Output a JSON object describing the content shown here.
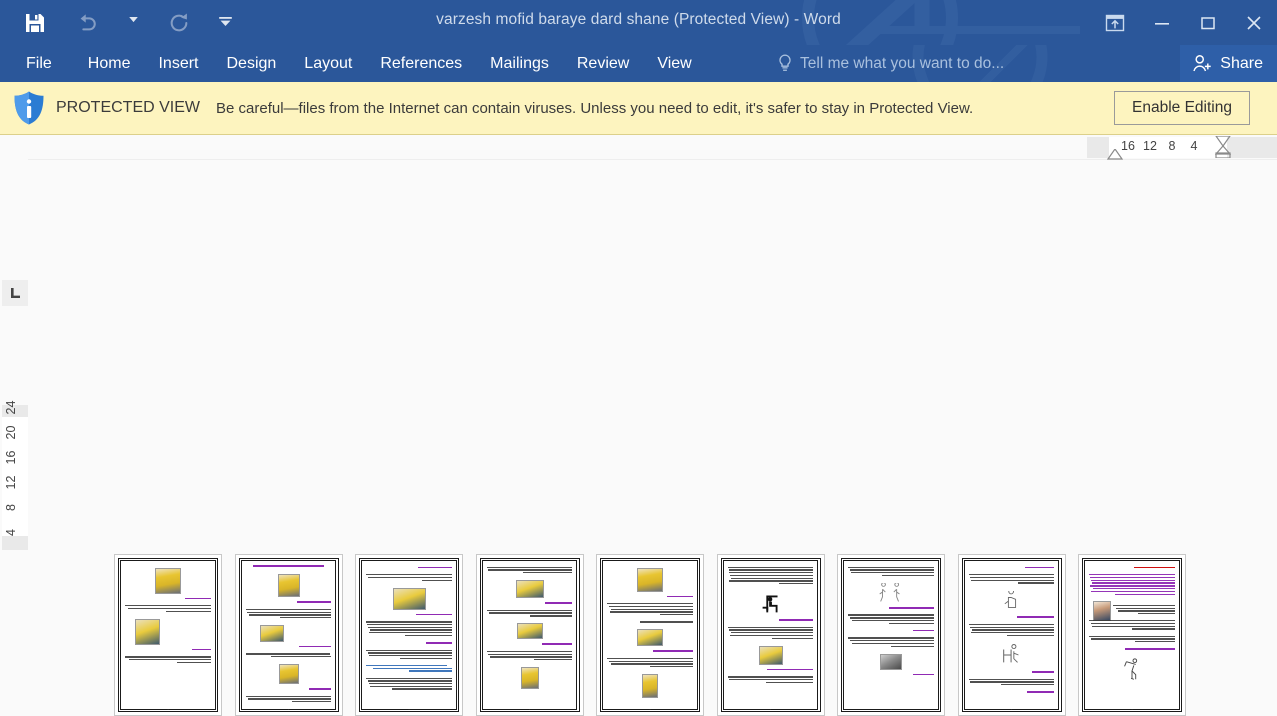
{
  "window": {
    "title": "varzesh mofid baraye dard shane (Protected View) - Word",
    "accent_color": "#2b579a",
    "quick_access": [
      {
        "name": "save-icon",
        "label": "Save",
        "enabled": true
      },
      {
        "name": "undo-icon",
        "label": "Undo",
        "enabled": false
      },
      {
        "name": "redo-icon",
        "label": "Redo",
        "enabled": false
      },
      {
        "name": "customize-quick-access-toolbar-icon",
        "label": "Customize Quick Access Toolbar",
        "enabled": true
      }
    ],
    "controls": [
      {
        "name": "ribbon-display-options-icon",
        "label": "Ribbon Display Options"
      },
      {
        "name": "minimize-icon",
        "label": "Minimize"
      },
      {
        "name": "restore-icon",
        "label": "Restore Down"
      },
      {
        "name": "close-icon",
        "label": "Close"
      }
    ]
  },
  "ribbon": {
    "tabs": [
      {
        "label": "File"
      },
      {
        "label": "Home"
      },
      {
        "label": "Insert"
      },
      {
        "label": "Design"
      },
      {
        "label": "Layout"
      },
      {
        "label": "References"
      },
      {
        "label": "Mailings"
      },
      {
        "label": "Review"
      },
      {
        "label": "View"
      }
    ],
    "tell_me_placeholder": "Tell me what you want to do...",
    "share_label": "Share"
  },
  "protected_view": {
    "badge": "PROTECTED VIEW",
    "message": "Be careful—files from the Internet can contain viruses. Unless you need to edit, it's safer to stay in Protected View.",
    "enable_button": "Enable Editing",
    "background_color": "#fdf4bf"
  },
  "rulers": {
    "tab_stop_selector": "L",
    "horizontal_numbers": [
      "16",
      "12",
      "8",
      "4"
    ],
    "vertical_numbers": [
      "24",
      "20",
      "16",
      "12",
      "8",
      "4"
    ]
  },
  "document": {
    "page_count": 9,
    "language_direction": "rtl",
    "pages": [
      {
        "number": 1,
        "heading_color": "#8a1fb0",
        "images": [
          "photo-yellow",
          "photo-yellow2"
        ]
      },
      {
        "number": 2,
        "heading_color": "#8a1fb0",
        "images": [
          "photo-yellow",
          "photo-yellow2",
          "photo-yellow"
        ]
      },
      {
        "number": 3,
        "heading_color": "#8a1fb0",
        "images": [
          "photo-yellow2"
        ]
      },
      {
        "number": 4,
        "heading_color": "#8a1fb0",
        "images": [
          "photo-yellow2",
          "photo-yellow2",
          "photo-yellow"
        ]
      },
      {
        "number": 5,
        "heading_color": "#8a1fb0",
        "images": [
          "photo-yellow",
          "photo-yellow2",
          "photo-yellow"
        ]
      },
      {
        "number": 6,
        "heading_color": "#8a1fb0",
        "images": [
          "line-art-chair",
          "photo-yellow2"
        ]
      },
      {
        "number": 7,
        "heading_color": "#8a1fb0",
        "images": [
          "line-art-figures",
          "photo-dark"
        ]
      },
      {
        "number": 8,
        "heading_color": "#8a1fb0",
        "images": [
          "line-art-torso",
          "line-art-chair2"
        ]
      },
      {
        "number": 9,
        "heading_color": "#cc0000",
        "images": [
          "photo-person",
          "line-art-bend"
        ]
      }
    ]
  },
  "status_bar": {
    "visible": false
  }
}
